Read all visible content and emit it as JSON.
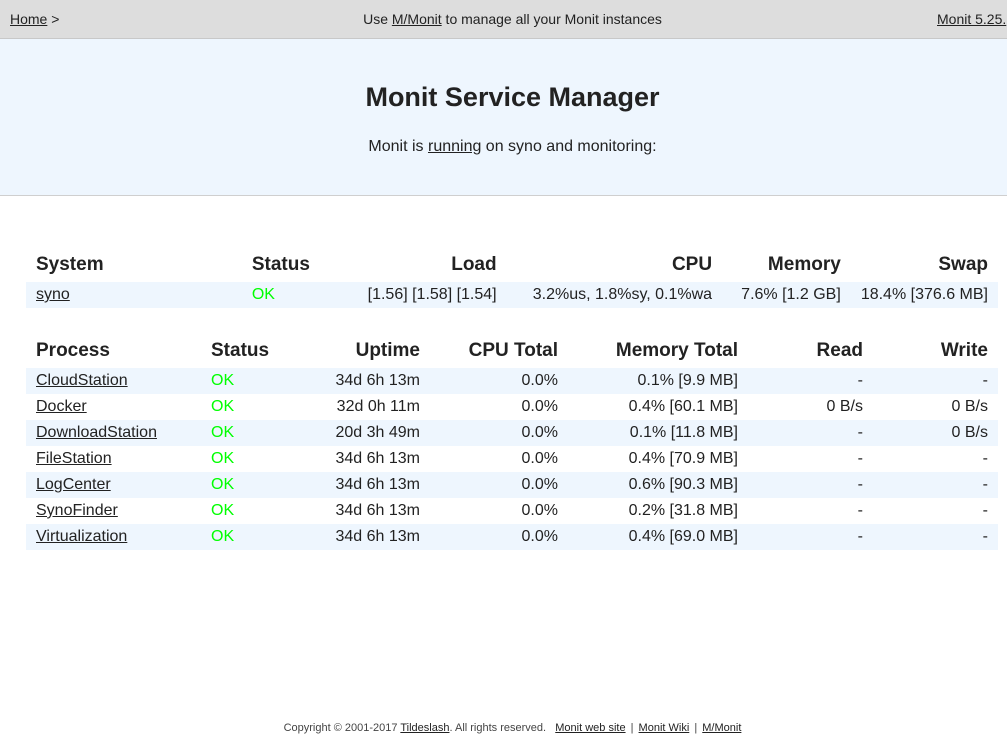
{
  "nav": {
    "home_label": "Home",
    "home_separator": ">",
    "center_prefix": "Use ",
    "center_link": "M/Monit",
    "center_suffix": " to manage all your Monit instances",
    "version_label": "Monit 5.25."
  },
  "header": {
    "title": "Monit Service Manager",
    "subtitle_prefix": "Monit is ",
    "subtitle_link": "running",
    "subtitle_suffix": " on syno and monitoring:"
  },
  "system_table": {
    "headers": [
      "System",
      "Status",
      "Load",
      "CPU",
      "Memory",
      "Swap"
    ],
    "row": {
      "name": "syno",
      "status": "OK",
      "load": "[1.56] [1.58] [1.54]",
      "cpu": "3.2%us, 1.8%sy, 0.1%wa",
      "memory": "7.6% [1.2 GB]",
      "swap": "18.4% [376.6 MB]"
    }
  },
  "process_table": {
    "headers": [
      "Process",
      "Status",
      "Uptime",
      "CPU Total",
      "Memory Total",
      "Read",
      "Write"
    ],
    "rows": [
      {
        "name": "CloudStation",
        "status": "OK",
        "uptime": "34d 6h 13m",
        "cpu": "0.0%",
        "memory": "0.1% [9.9 MB]",
        "read": "-",
        "write": "-"
      },
      {
        "name": "Docker",
        "status": "OK",
        "uptime": "32d 0h 11m",
        "cpu": "0.0%",
        "memory": "0.4% [60.1 MB]",
        "read": "0 B/s",
        "write": "0 B/s"
      },
      {
        "name": "DownloadStation",
        "status": "OK",
        "uptime": "20d 3h 49m",
        "cpu": "0.0%",
        "memory": "0.1% [11.8 MB]",
        "read": "-",
        "write": "0 B/s"
      },
      {
        "name": "FileStation",
        "status": "OK",
        "uptime": "34d 6h 13m",
        "cpu": "0.0%",
        "memory": "0.4% [70.9 MB]",
        "read": "-",
        "write": "-"
      },
      {
        "name": "LogCenter",
        "status": "OK",
        "uptime": "34d 6h 13m",
        "cpu": "0.0%",
        "memory": "0.6% [90.3 MB]",
        "read": "-",
        "write": "-"
      },
      {
        "name": "SynoFinder",
        "status": "OK",
        "uptime": "34d 6h 13m",
        "cpu": "0.0%",
        "memory": "0.2% [31.8 MB]",
        "read": "-",
        "write": "-"
      },
      {
        "name": "Virtualization",
        "status": "OK",
        "uptime": "34d 6h 13m",
        "cpu": "0.0%",
        "memory": "0.4% [69.0 MB]",
        "read": "-",
        "write": "-"
      }
    ]
  },
  "footer": {
    "copyright": "Copyright © 2001-2017 ",
    "company_link": "Tildeslash",
    "rights": ". All rights reserved.",
    "links": [
      "Monit web site",
      "Monit Wiki",
      "M/Monit"
    ],
    "separator": "|"
  },
  "colors": {
    "nav_bg": "#dddddd",
    "header_bg": "#eef6fe",
    "row_stripe": "#eef6fe",
    "status_ok": "#00ff00"
  }
}
